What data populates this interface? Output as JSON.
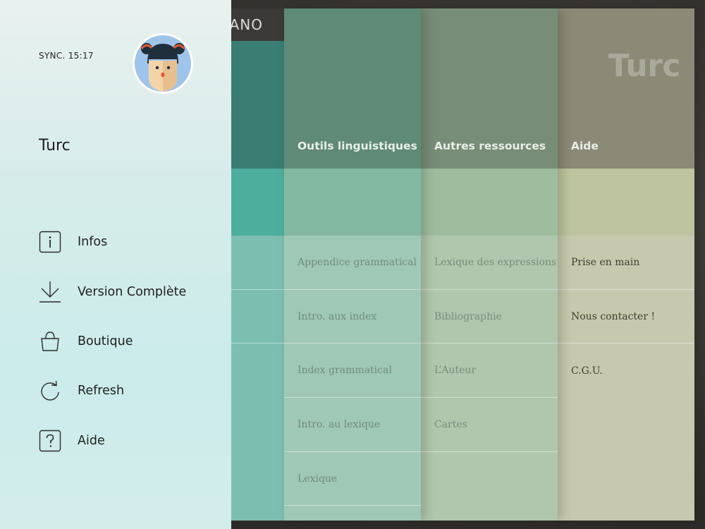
{
  "brand": {
    "text": "ANO"
  },
  "drawer": {
    "sync_text": "SYNC. 15:17",
    "language_title": "Turc",
    "menu": [
      {
        "label": "Infos",
        "icon": "info-icon"
      },
      {
        "label": "Version Complète",
        "icon": "download-icon"
      },
      {
        "label": "Boutique",
        "icon": "shopping-bag-icon"
      },
      {
        "label": "Refresh",
        "icon": "refresh-icon"
      },
      {
        "label": "Aide",
        "icon": "help-icon"
      }
    ]
  },
  "board": {
    "language_watermark": "Turc",
    "columns": [
      {
        "title": "Outils linguistiques",
        "items": [
          "Appendice grammatical",
          "Intro. aux index",
          "Index grammatical",
          "Intro. au lexique",
          "Lexique"
        ]
      },
      {
        "title": "Autres ressources",
        "items": [
          "Lexique des expressions",
          "Bibliographie",
          "L’Auteur",
          "Cartes"
        ]
      },
      {
        "title": "Aide",
        "items": [
          "Prise en main",
          "Nous contacter !",
          "C.G.U."
        ]
      }
    ]
  },
  "colors": {
    "drawer_bg": "#d3edeb",
    "col_outils_head": "#5f8a77",
    "col_autres_head": "#778d78",
    "col_aide_head": "#8a8a76",
    "teal_accent": "#3a7d72"
  }
}
